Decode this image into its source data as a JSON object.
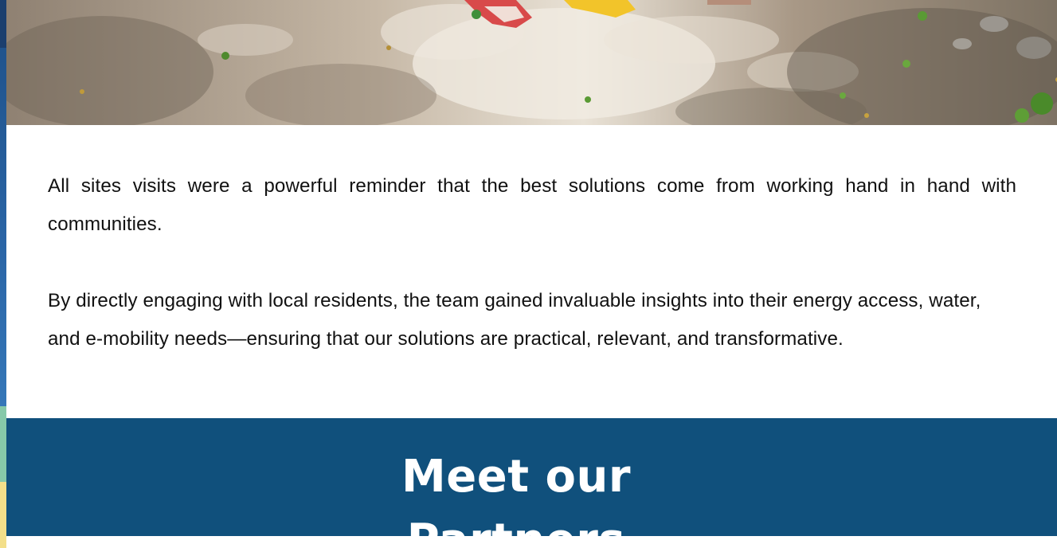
{
  "paragraphs": {
    "p1": "All sites visits were a powerful reminder that the best solutions come from working hand in hand with communities.",
    "p2": "By directly engaging with local residents, the team gained invaluable insights into their energy access, water, and e-mobility needs—ensuring that our solutions are practical, relevant, and transformative."
  },
  "partners": {
    "heading": "Meet our Partners"
  },
  "colors": {
    "band": "#10507c",
    "text": "#111111",
    "heading": "#ffffff"
  }
}
